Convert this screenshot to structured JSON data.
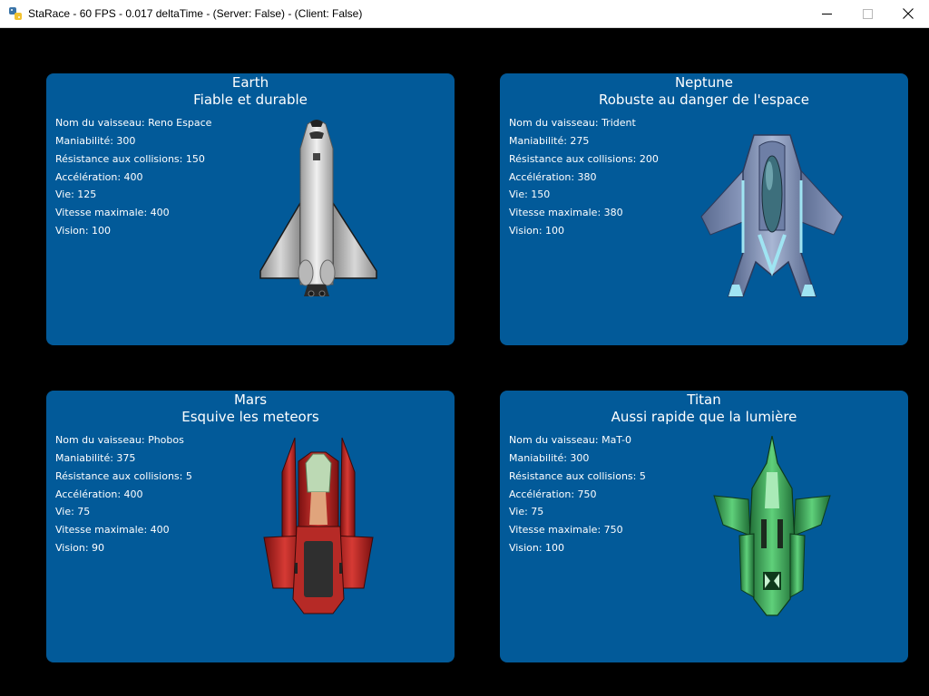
{
  "window": {
    "title": "StaRace - 60 FPS - 0.017 deltaTime - (Server: False) - (Client: False)"
  },
  "cards": [
    {
      "planet": "Earth",
      "tagline": "Fiable et durable",
      "stats": [
        "Nom du vaisseau: Reno Espace",
        "Maniabilité: 300",
        "Résistance aux collisions: 150",
        "Accélération: 400",
        "Vie: 125",
        "Vitesse maximale: 400",
        "Vision: 100"
      ]
    },
    {
      "planet": "Neptune",
      "tagline": "Robuste au danger de l'espace",
      "stats": [
        "Nom du vaisseau: Trident",
        "Maniabilité: 275",
        "Résistance aux collisions: 200",
        "Accélération: 380",
        "Vie: 150",
        "Vitesse maximale: 380",
        "Vision: 100"
      ]
    },
    {
      "planet": "Mars",
      "tagline": "Esquive les meteors",
      "stats": [
        "Nom du vaisseau: Phobos",
        "Maniabilité: 375",
        "Résistance aux collisions: 5",
        "Accélération: 400",
        "Vie: 75",
        "Vitesse maximale: 400",
        "Vision: 90"
      ]
    },
    {
      "planet": "Titan",
      "tagline": "Aussi rapide que la lumière",
      "stats": [
        "Nom du vaisseau: MaT-0",
        "Maniabilité: 300",
        "Résistance aux collisions: 5",
        "Accélération: 750",
        "Vie: 75",
        "Vitesse maximale: 750",
        "Vision: 100"
      ]
    }
  ],
  "colors": {
    "background": "#000000",
    "card": "#025a99",
    "text": "#ffffff"
  },
  "icons": {
    "app": "python-icon",
    "minimize": "minimize-icon",
    "maximize": "maximize-icon",
    "close": "close-icon"
  }
}
